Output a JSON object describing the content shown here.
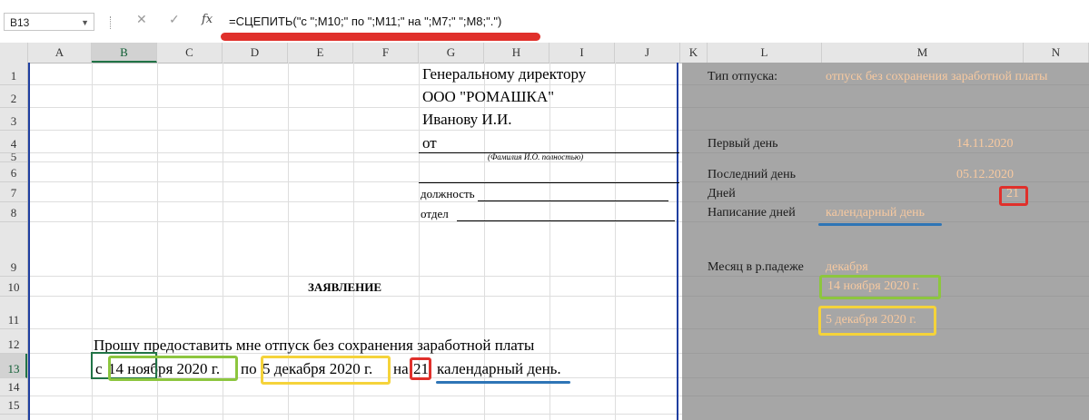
{
  "formula_bar": {
    "name_box": "B13",
    "cancel_icon": "✕",
    "enter_icon": "✓",
    "fx_label": "fx",
    "formula": "=СЦЕПИТЬ(\"с \";M10;\" по \";M11;\" на \";M7;\" \";M8;\".\")"
  },
  "columns": [
    "A",
    "B",
    "C",
    "D",
    "E",
    "F",
    "G",
    "H",
    "I",
    "J",
    "K",
    "L",
    "M",
    "N"
  ],
  "rows": [
    "1",
    "2",
    "3",
    "4",
    "5",
    "6",
    "7",
    "8",
    "9",
    "10",
    "11",
    "12",
    "13",
    "14",
    "15"
  ],
  "selected_cell": "B13",
  "document": {
    "header_line1": "Генеральному директору",
    "header_line2": "ООО \"РОМАШКА\"",
    "header_line3": "Иванову И.И.",
    "from_label": "от",
    "fio_hint": "(Фамилия И.О. полностью)",
    "position_label": "должность",
    "department_label": "отдел",
    "title": "ЗАЯВЛЕНИЕ",
    "body_line1": "Прошу предоставить мне отпуск без сохранения заработной платы",
    "body_c": "с",
    "body_from_date": "14 ноября 2020 г.",
    "body_po": "по",
    "body_to_date": "5 декабря 2020 г.",
    "body_na": "на",
    "body_days": "21",
    "body_days_word": "календарный день."
  },
  "side_panel": {
    "leave_type_label": "Тип отпуска:",
    "leave_type_value": "отпуск без сохранения заработной платы",
    "first_day_label": "Первый день",
    "first_day_value": "14.11.2020",
    "last_day_label": "Последний день",
    "last_day_value": "05.12.2020",
    "days_label": "Дней",
    "days_value": "21",
    "days_spelling_label": "Написание дней",
    "days_spelling_value": "календарный день",
    "month_genitive_label": "Месяц в р.падеже",
    "month_genitive_value": "декабря",
    "from_date_text": "14 ноября 2020 г.",
    "to_date_text": "5 декабря 2020 г."
  },
  "colors": {
    "annotation_red": "#e0302b",
    "annotation_green": "#8dc63f",
    "annotation_yellow": "#f5d33a",
    "annotation_blue": "#2e75b6",
    "excel_green": "#217346",
    "panel_gray": "#a6a6a6",
    "panel_value": "#f7c9a0"
  }
}
